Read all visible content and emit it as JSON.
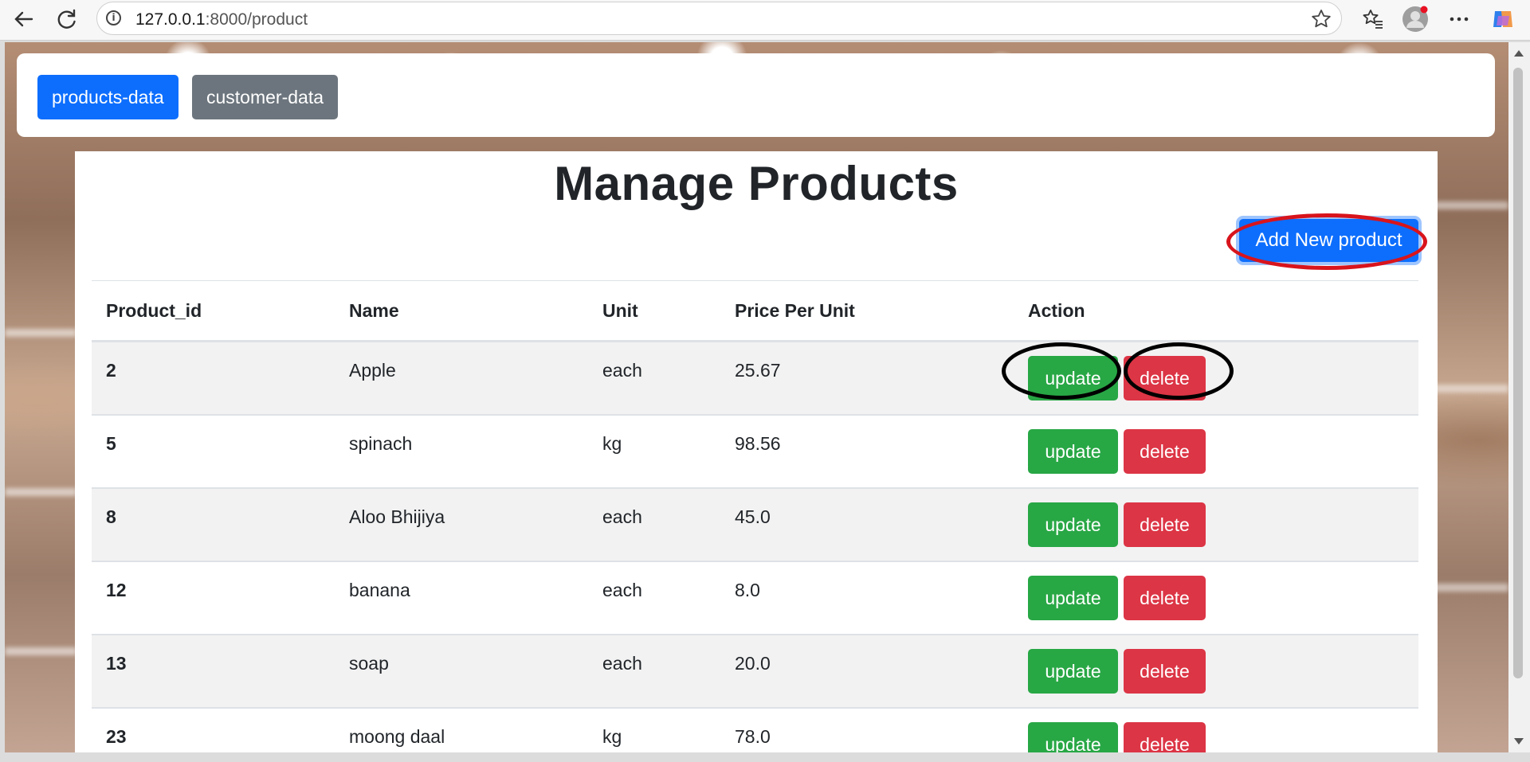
{
  "browser": {
    "url_host": "127.0.0.1",
    "url_path": ":8000/product"
  },
  "nav": {
    "products_label": "products-data",
    "customers_label": "customer-data"
  },
  "main": {
    "title": "Manage Products",
    "add_button_label": "Add New product"
  },
  "table": {
    "headers": {
      "id": "Product_id",
      "name": "Name",
      "unit": "Unit",
      "price": "Price Per Unit",
      "action": "Action"
    },
    "update_label": "update",
    "delete_label": "delete",
    "rows": [
      {
        "id": "2",
        "name": "Apple",
        "unit": "each",
        "price": "25.67"
      },
      {
        "id": "5",
        "name": "spinach",
        "unit": "kg",
        "price": "98.56"
      },
      {
        "id": "8",
        "name": "Aloo Bhijiya",
        "unit": "each",
        "price": "45.0"
      },
      {
        "id": "12",
        "name": "banana",
        "unit": "each",
        "price": "8.0"
      },
      {
        "id": "13",
        "name": "soap",
        "unit": "each",
        "price": "20.0"
      },
      {
        "id": "23",
        "name": "moong daal",
        "unit": "kg",
        "price": "78.0"
      }
    ]
  },
  "colors": {
    "primary": "#0d6efd",
    "secondary": "#6c757d",
    "success": "#28a745",
    "danger": "#dc3545",
    "annotation_red": "#d8141c",
    "annotation_black": "#000000"
  },
  "icons": [
    "back-arrow-icon",
    "reload-icon",
    "info-icon",
    "star-icon",
    "favorites-icon",
    "profile-icon",
    "more-icon",
    "copilot-icon"
  ]
}
